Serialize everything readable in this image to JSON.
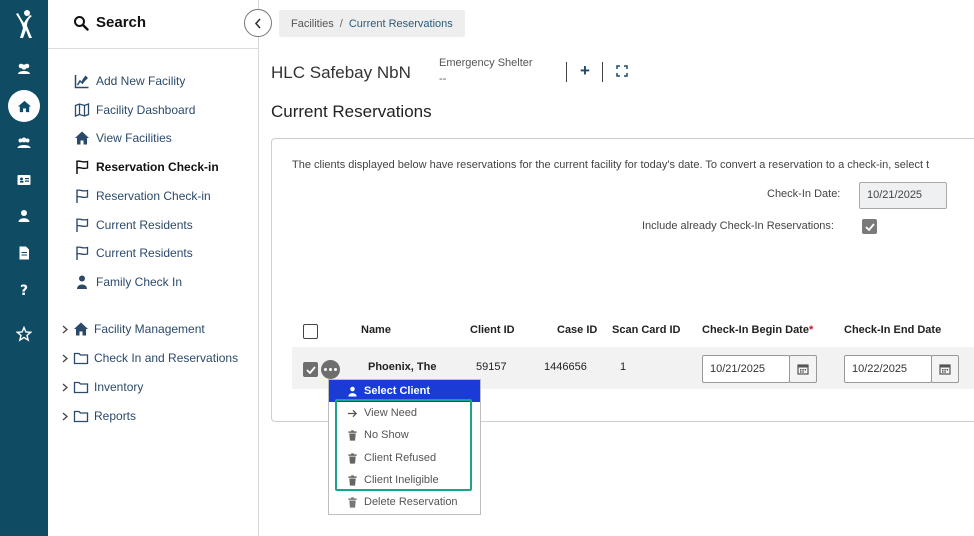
{
  "rail": {
    "icons": [
      "logo-icon",
      "people-icon",
      "home-icon",
      "group-icon",
      "id-card-icon",
      "user-icon",
      "document-icon",
      "help-icon",
      "star-icon"
    ]
  },
  "nav": {
    "search_label": "Search",
    "items": [
      {
        "label": "Add New Facility",
        "icon": "chart-edit-icon"
      },
      {
        "label": "Facility Dashboard",
        "icon": "map-icon"
      },
      {
        "label": "View Facilities",
        "icon": "house-icon"
      },
      {
        "label": "Reservation Check-in",
        "icon": "flag-icon"
      },
      {
        "label": "Reservation Check-in",
        "icon": "flag-icon"
      },
      {
        "label": "Current Residents",
        "icon": "flag-icon"
      },
      {
        "label": "Current Residents",
        "icon": "flag-icon"
      },
      {
        "label": "Family Check In",
        "icon": "person-icon"
      }
    ],
    "groups": [
      {
        "label": "Facility Management",
        "icon": "house-icon"
      },
      {
        "label": "Check In and Reservations",
        "icon": "folder-icon"
      },
      {
        "label": "Inventory",
        "icon": "folder-icon"
      },
      {
        "label": "Reports",
        "icon": "folder-icon"
      }
    ]
  },
  "breadcrumb": {
    "parent": "Facilities",
    "separator": "/",
    "current": "Current Reservations"
  },
  "facility": {
    "name": "HLC Safebay NbN",
    "type": "Emergency Shelter",
    "type_value": "--"
  },
  "page": {
    "title": "Current Reservations"
  },
  "panel": {
    "description": "The clients displayed below have reservations for the current facility for today's date. To convert a reservation to a check-in, select t",
    "checkin_date_label": "Check-In Date:",
    "checkin_date_value": "10/21/2025",
    "include_label": "Include already Check-In Reservations:",
    "include_checked": true
  },
  "table": {
    "columns": [
      "Name",
      "Client ID",
      "Case ID",
      "Scan Card ID",
      "Check-In Begin Date",
      "Check-In End Date"
    ],
    "required_marker": "*",
    "rows": [
      {
        "name": "Phoenix, The",
        "client_id": "59157",
        "case_id": "1446656",
        "scan_card_id": "1",
        "begin_date": "10/21/2025",
        "end_date": "10/22/2025",
        "checked": true
      }
    ]
  },
  "menu": {
    "items": [
      {
        "label": "Select Client",
        "icon": "person-icon"
      },
      {
        "label": "View Need",
        "icon": "arrow-right-icon"
      },
      {
        "label": "No Show",
        "icon": "trash-icon"
      },
      {
        "label": "Client Refused",
        "icon": "trash-icon"
      },
      {
        "label": "Client Ineligible",
        "icon": "trash-icon"
      },
      {
        "label": "Delete Reservation",
        "icon": "trash-icon"
      }
    ]
  },
  "colors": {
    "rail": "#0f4b63",
    "menu_selected": "#1a3bd6",
    "highlight": "#1aa58a",
    "link": "#2b4a6a"
  }
}
